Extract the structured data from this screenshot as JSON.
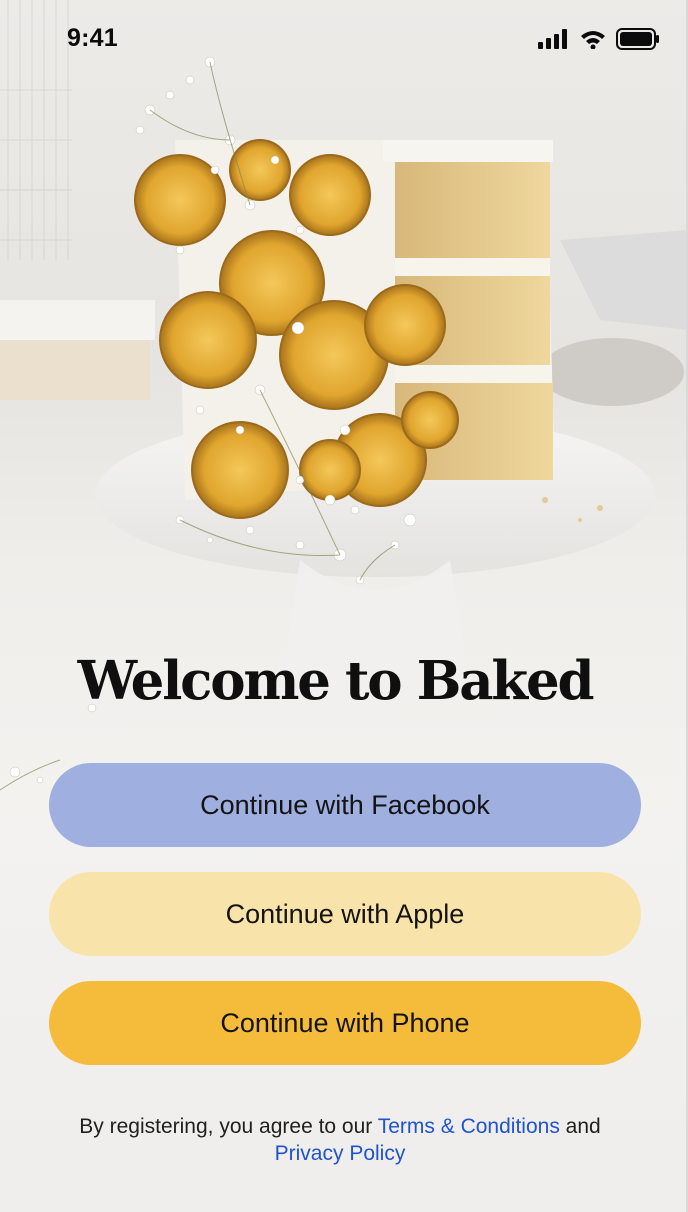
{
  "status_bar": {
    "time": "9:41",
    "icons": [
      "cellular-signal-icon",
      "wifi-icon",
      "battery-icon"
    ]
  },
  "hero": {
    "image": "cake-photo",
    "title": "Welcome to Baked"
  },
  "auth_buttons": {
    "facebook": "Continue with Facebook",
    "apple": "Continue with Apple",
    "phone": "Continue with Phone"
  },
  "legal": {
    "prefix": "By registering, you agree to our",
    "terms_link": "Terms & Conditions",
    "conjunction": "and",
    "privacy_link": "Privacy Policy"
  },
  "colors": {
    "facebook_button": "#9eafe0",
    "apple_button": "#f8e4ab",
    "phone_button": "#f5bc3c",
    "link": "#1f53cf"
  }
}
